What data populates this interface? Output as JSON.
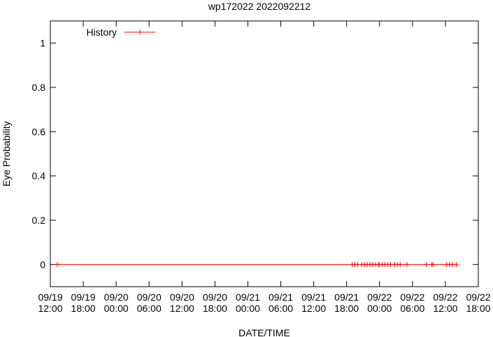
{
  "chart_data": {
    "type": "line",
    "title": "wp172022 2022092212",
    "xlabel": "DATE/TIME",
    "ylabel": "Eye Probability",
    "xlim": [
      "2022-09-19T12:00",
      "2022-09-22T18:00"
    ],
    "ylim": [
      -0.1,
      1.1
    ],
    "yticks": [
      0,
      0.2,
      0.4,
      0.6,
      0.8,
      1
    ],
    "ytick_labels": [
      "0",
      "0.2",
      "0.4",
      "0.6",
      "0.8",
      "1"
    ],
    "xticks": [
      {
        "x": "2022-09-19T12:00",
        "line1": "09/19",
        "line2": "12:00"
      },
      {
        "x": "2022-09-19T18:00",
        "line1": "09/19",
        "line2": "18:00"
      },
      {
        "x": "2022-09-20T00:00",
        "line1": "09/20",
        "line2": "00:00"
      },
      {
        "x": "2022-09-20T06:00",
        "line1": "09/20",
        "line2": "06:00"
      },
      {
        "x": "2022-09-20T12:00",
        "line1": "09/20",
        "line2": "12:00"
      },
      {
        "x": "2022-09-20T18:00",
        "line1": "09/20",
        "line2": "18:00"
      },
      {
        "x": "2022-09-21T00:00",
        "line1": "09/21",
        "line2": "00:00"
      },
      {
        "x": "2022-09-21T06:00",
        "line1": "09/21",
        "line2": "06:00"
      },
      {
        "x": "2022-09-21T12:00",
        "line1": "09/21",
        "line2": "12:00"
      },
      {
        "x": "2022-09-21T18:00",
        "line1": "09/21",
        "line2": "18:00"
      },
      {
        "x": "2022-09-22T00:00",
        "line1": "09/22",
        "line2": "00:00"
      },
      {
        "x": "2022-09-22T06:00",
        "line1": "09/22",
        "line2": "06:00"
      },
      {
        "x": "2022-09-22T12:00",
        "line1": "09/22",
        "line2": "12:00"
      },
      {
        "x": "2022-09-22T18:00",
        "line1": "09/22",
        "line2": "18:00"
      }
    ],
    "grid": false,
    "legend_position": "top-left",
    "series": [
      {
        "name": "History",
        "color": "#ff0000",
        "marker": "plus",
        "points": [
          {
            "x": "2022-09-19T13:15",
            "y": 0
          },
          {
            "x": "2022-09-21T19:00",
            "y": 0
          },
          {
            "x": "2022-09-21T19:30",
            "y": 0
          },
          {
            "x": "2022-09-21T20:00",
            "y": 0
          },
          {
            "x": "2022-09-21T20:45",
            "y": 0
          },
          {
            "x": "2022-09-21T21:15",
            "y": 0
          },
          {
            "x": "2022-09-21T21:45",
            "y": 0
          },
          {
            "x": "2022-09-21T22:15",
            "y": 0
          },
          {
            "x": "2022-09-21T22:45",
            "y": 0
          },
          {
            "x": "2022-09-21T23:15",
            "y": 0
          },
          {
            "x": "2022-09-21T23:45",
            "y": 0
          },
          {
            "x": "2022-09-22T00:00",
            "y": 0
          },
          {
            "x": "2022-09-22T00:30",
            "y": 0
          },
          {
            "x": "2022-09-22T01:00",
            "y": 0
          },
          {
            "x": "2022-09-22T01:30",
            "y": 0
          },
          {
            "x": "2022-09-22T02:00",
            "y": 0
          },
          {
            "x": "2022-09-22T02:45",
            "y": 0
          },
          {
            "x": "2022-09-22T03:15",
            "y": 0
          },
          {
            "x": "2022-09-22T03:45",
            "y": 0
          },
          {
            "x": "2022-09-22T05:00",
            "y": 0
          },
          {
            "x": "2022-09-22T08:30",
            "y": 0
          },
          {
            "x": "2022-09-22T09:30",
            "y": 0
          },
          {
            "x": "2022-09-22T09:45",
            "y": 0
          },
          {
            "x": "2022-09-22T12:15",
            "y": 0
          },
          {
            "x": "2022-09-22T12:45",
            "y": 0
          },
          {
            "x": "2022-09-22T13:15",
            "y": 0
          },
          {
            "x": "2022-09-22T14:00",
            "y": 0
          }
        ]
      }
    ]
  }
}
